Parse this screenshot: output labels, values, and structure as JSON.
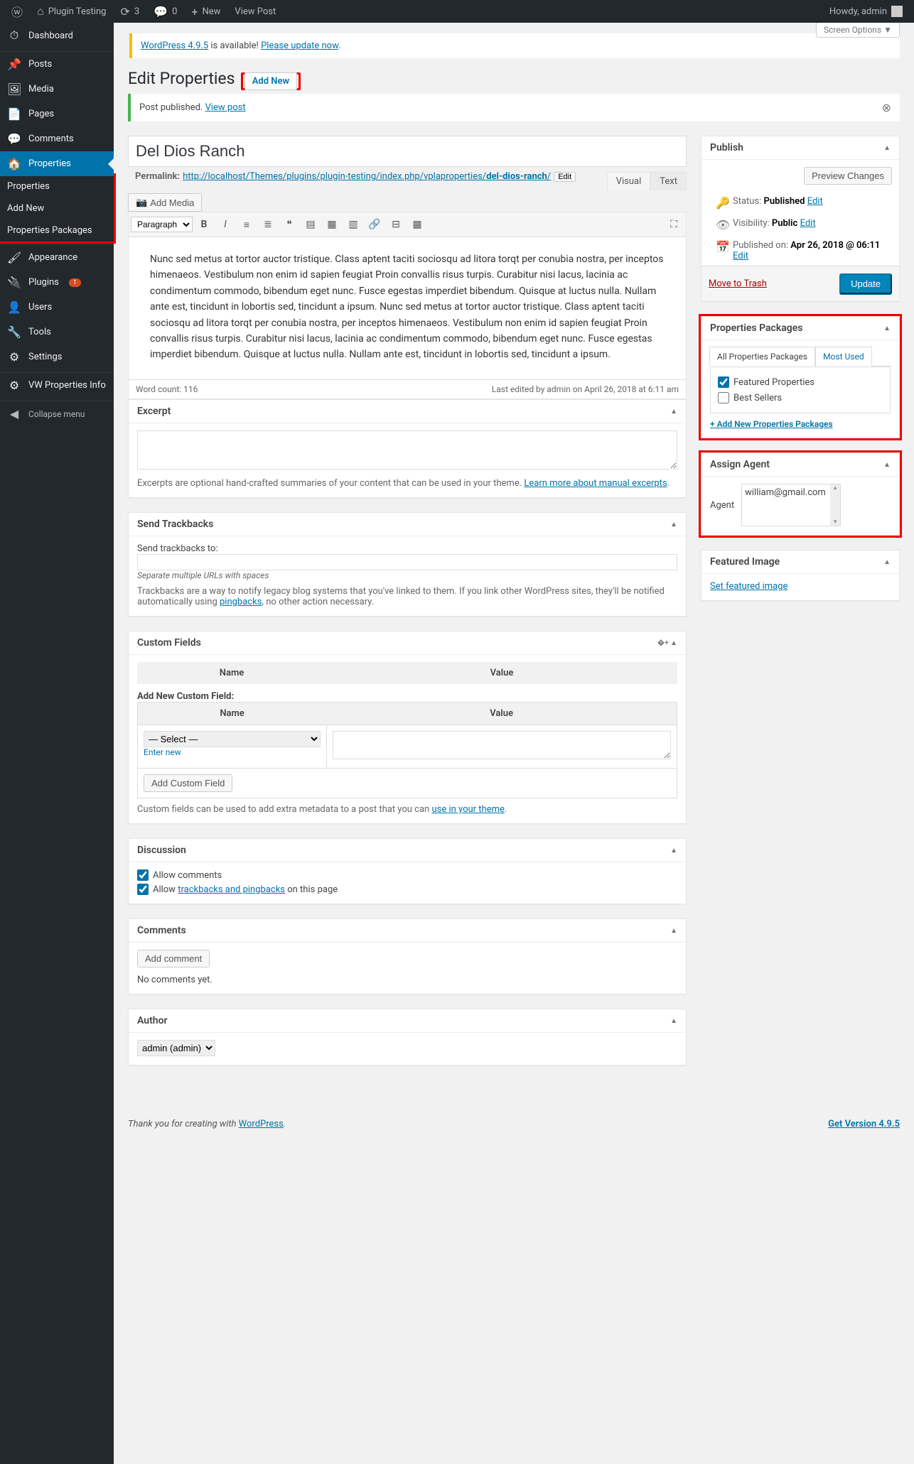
{
  "toolbar": {
    "site_name": "Plugin Testing",
    "updates": "3",
    "comments": "0",
    "new": "New",
    "view": "View Post",
    "howdy": "Howdy, admin"
  },
  "sidebar": {
    "items": [
      {
        "icon": "⏱",
        "label": "Dashboard"
      },
      {
        "icon": "📌",
        "label": "Posts"
      },
      {
        "icon": "🖼",
        "label": "Media"
      },
      {
        "icon": "📄",
        "label": "Pages"
      },
      {
        "icon": "💬",
        "label": "Comments"
      },
      {
        "icon": "🏠",
        "label": "Properties"
      }
    ],
    "properties_sub": [
      {
        "label": "Properties"
      },
      {
        "label": "Add New"
      },
      {
        "label": "Properties Packages"
      }
    ],
    "items2": [
      {
        "icon": "🖌",
        "label": "Appearance"
      },
      {
        "icon": "🔌",
        "label": "Plugins",
        "badge": "1"
      },
      {
        "icon": "👤",
        "label": "Users"
      },
      {
        "icon": "🔧",
        "label": "Tools"
      },
      {
        "icon": "⚙",
        "label": "Settings"
      },
      {
        "icon": "⚙",
        "label": "VW Properties Info"
      }
    ],
    "collapse": "Collapse menu"
  },
  "screen_options": "Screen Options",
  "update_nag": {
    "a": "WordPress 4.9.5",
    "b": " is available! ",
    "c": "Please update now"
  },
  "heading": "Edit Properties",
  "add_new": "Add New",
  "notice": {
    "text": "Post published. ",
    "link": "View post"
  },
  "title": "Del Dios Ranch",
  "permalink": {
    "label": "Permalink:",
    "base": "http://localhost/Themes/plugins/plugin-testing/index.php/vplaproperties/",
    "slug": "del-dios-ranch",
    "slash": "/",
    "edit": "Edit"
  },
  "media_button": "Add Media",
  "editor_tabs": {
    "visual": "Visual",
    "text": "Text"
  },
  "toolbar_format": "Paragraph",
  "content_body": "Nunc sed metus at tortor auctor tristique. Class aptent taciti sociosqu ad litora torqt per conubia nostra, per inceptos himenaeos. Vestibulum non enim id sapien feugiat Proin convallis risus turpis. Curabitur nisi lacus, lacinia ac condimentum commodo, bibendum eget nunc. Fusce egestas imperdiet bibendum. Quisque at luctus nulla. Nullam ante est, tincidunt in lobortis sed, tincidunt a ipsum. Nunc sed metus at tortor auctor tristique. Class aptent taciti sociosqu ad litora torqt per conubia nostra, per inceptos himenaeos. Vestibulum non enim id sapien feugiat Proin convallis risus turpis. Curabitur nisi lacus, lacinia ac condimentum commodo, bibendum eget nunc. Fusce egestas imperdiet bibendum. Quisque at luctus nulla. Nullam ante est, tincidunt in lobortis sed, tincidunt a ipsum.",
  "statusbar": {
    "words": "Word count: 116",
    "lastedit": "Last edited by admin on April 26, 2018 at 6:11 am"
  },
  "excerpt": {
    "title": "Excerpt",
    "desc_a": "Excerpts are optional hand-crafted summaries of your content that can be used in your theme. ",
    "desc_link": "Learn more about manual excerpts",
    "desc_b": "."
  },
  "trackbacks": {
    "title": "Send Trackbacks",
    "label": "Send trackbacks to:",
    "howto": "Separate multiple URLs with spaces",
    "desc_a": "Trackbacks are a way to notify legacy blog systems that you've linked to them. If you link other WordPress sites, they'll be notified automatically using ",
    "desc_link": "pingbacks",
    "desc_b": ", no other action necessary."
  },
  "customfields": {
    "title": "Custom Fields",
    "name": "Name",
    "value": "Value",
    "add_label": "Add New Custom Field:",
    "select_opt": "— Select —",
    "enter_new": "Enter new",
    "add_btn": "Add Custom Field",
    "desc_a": "Custom fields can be used to add extra metadata to a post that you can ",
    "desc_link": "use in your theme",
    "desc_b": "."
  },
  "discussion": {
    "title": "Discussion",
    "allow_comments": "Allow comments",
    "allow_a": "Allow ",
    "allow_link": "trackbacks and pingbacks",
    "allow_b": " on this page"
  },
  "comments": {
    "title": "Comments",
    "add": "Add comment",
    "none": "No comments yet."
  },
  "author": {
    "title": "Author",
    "option": "admin (admin)"
  },
  "publish": {
    "title": "Publish",
    "preview": "Preview Changes",
    "status_l": "Status: ",
    "status_v": "Published",
    "vis_l": "Visibility: ",
    "vis_v": "Public",
    "pub_l": "Published on: ",
    "pub_v": "Apr 26, 2018 @ 06:11",
    "edit": "Edit",
    "trash": "Move to Trash",
    "update": "Update"
  },
  "packages": {
    "title": "Properties Packages",
    "tab_all": "All Properties Packages",
    "tab_most": "Most Used",
    "opt1": "Featured Properties",
    "opt2": "Best Sellers",
    "add": "+ Add New Properties Packages"
  },
  "agent": {
    "title": "Assign Agent",
    "label": "Agent",
    "value": "william@gmail.com"
  },
  "featured": {
    "title": "Featured Image",
    "set": "Set featured image"
  },
  "footer": {
    "thank": "Thank you for creating with ",
    "wp": "WordPress",
    "dot": ".",
    "version": "Get Version 4.9.5"
  }
}
